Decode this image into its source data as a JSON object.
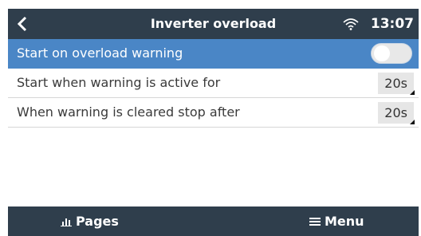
{
  "header": {
    "back_icon": "chevron-left-icon",
    "title": "Inverter overload",
    "wifi_icon": "wifi-icon",
    "time": "13:07"
  },
  "rows": [
    {
      "label": "Start on overload warning",
      "control": "toggle",
      "state": "off",
      "selected": true
    },
    {
      "label": "Start when warning is active for",
      "value": "20s"
    },
    {
      "label": "When warning is cleared stop after",
      "value": "20s"
    }
  ],
  "footer": {
    "pages_icon": "bar-chart-icon",
    "pages_label": "Pages",
    "menu_icon": "hamburger-menu-icon",
    "menu_label": "Menu"
  },
  "colors": {
    "header_bg": "#2f3e4c",
    "selected_row_bg": "#4a86c6",
    "value_bg": "#e6e6e6"
  }
}
